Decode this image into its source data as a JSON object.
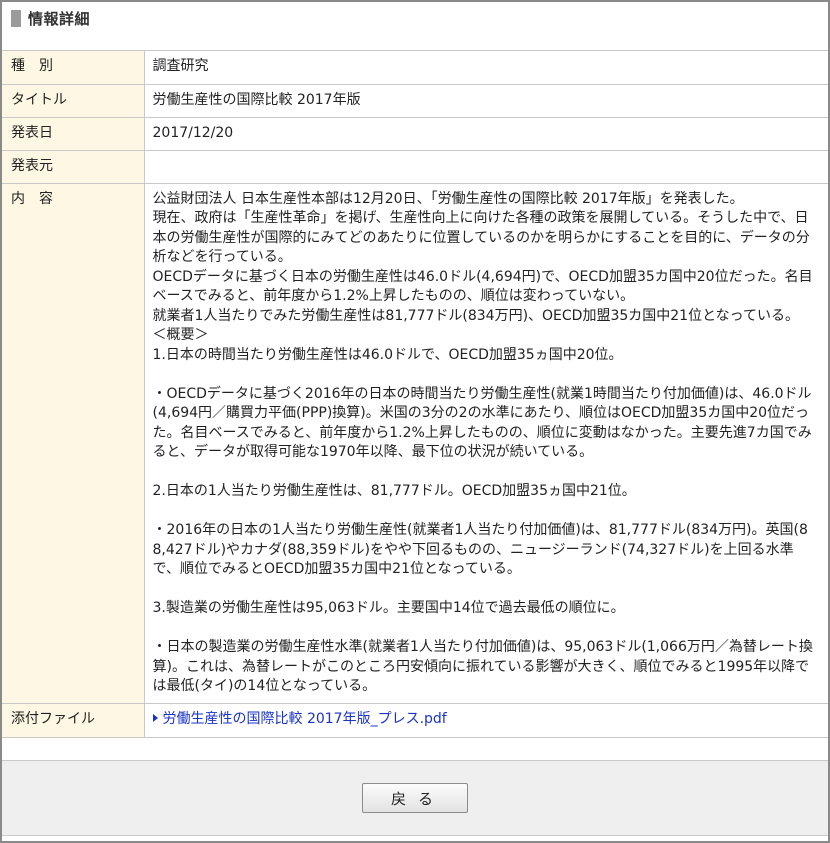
{
  "header": {
    "title": "情報詳細"
  },
  "rows": {
    "type": {
      "label": "種　別",
      "value": "調査研究"
    },
    "title": {
      "label": "タイトル",
      "value": "労働生産性の国際比較 2017年版"
    },
    "date": {
      "label": "発表日",
      "value": "2017/12/20"
    },
    "source": {
      "label": "発表元",
      "value": ""
    },
    "content": {
      "label": "内　容",
      "lines": [
        "公益財団法人 日本生産性本部は12月20日、「労働生産性の国際比較 2017年版」を発表した。",
        "現在、政府は「生産性革命」を掲げ、生産性向上に向けた各種の政策を展開している。そうした中で、日本の労働生産性が国際的にみてどのあたりに位置しているのかを明らかにすることを目的に、データの分析などを行っている。",
        "OECDデータに基づく日本の労働生産性は46.0ドル(4,694円)で、OECD加盟35カ国中20位だった。名目ベースでみると、前年度から1.2%上昇したものの、順位は変わっていない。",
        "就業者1人当たりでみた労働生産性は81,777ドル(834万円)、OECD加盟35カ国中21位となっている。",
        "＜概要＞",
        "1.日本の時間当たり労働生産性は46.0ドルで、OECD加盟35ヵ国中20位。",
        "",
        "・OECDデータに基づく2016年の日本の時間当たり労働生産性(就業1時間当たり付加価値)は、46.0ドル(4,694円／購買力平価(PPP)換算)。米国の3分の2の水準にあたり、順位はOECD加盟35カ国中20位だった。名目ベースでみると、前年度から1.2%上昇したものの、順位に変動はなかった。主要先進7カ国でみると、データが取得可能な1970年以降、最下位の状況が続いている。",
        "",
        "2.日本の1人当たり労働生産性は、81,777ドル。OECD加盟35ヵ国中21位。",
        "",
        "・2016年の日本の1人当たり労働生産性(就業者1人当たり付加価値)は、81,777ドル(834万円)。英国(88,427ドル)やカナダ(88,359ドル)をやや下回るものの、ニュージーランド(74,327ドル)を上回る水準で、順位でみるとOECD加盟35カ国中21位となっている。",
        "",
        "3.製造業の労働生産性は95,063ドル。主要国中14位で過去最低の順位に。",
        "",
        "・日本の製造業の労働生産性水準(就業者1人当たり付加価値)は、95,063ドル(1,066万円／為替レート換算)。これは、為替レートがこのところ円安傾向に振れている影響が大きく、順位でみると1995年以降では最低(タイ)の14位となっている。"
      ]
    },
    "attachment": {
      "label": "添付ファイル",
      "file_name": "労働生産性の国際比較 2017年版_プレス.pdf",
      "icon": "triangle-right-icon"
    }
  },
  "footer": {
    "back_label": "戻る"
  },
  "colors": {
    "label_bg": "#fdf7e3",
    "border": "#c9c9c9",
    "link": "#1a33cc",
    "footer_bg": "#efefef",
    "header_bar": "#9b9b9b"
  }
}
